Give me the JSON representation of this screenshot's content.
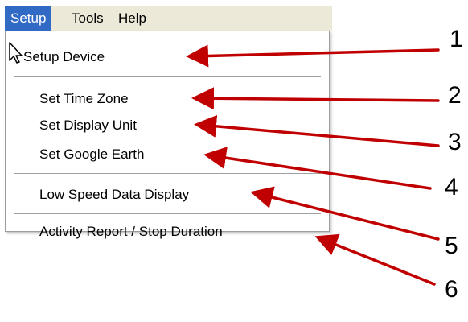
{
  "menubar": {
    "items": [
      {
        "label": "Setup",
        "active": true
      },
      {
        "label": "Tools",
        "active": false
      },
      {
        "label": "Help",
        "active": false
      }
    ]
  },
  "setup_menu": {
    "items": [
      {
        "label": "Setup Device",
        "hovered": true
      },
      {
        "label": "Set Time Zone"
      },
      {
        "label": "Set Display Unit"
      },
      {
        "label": "Set Google Earth"
      },
      {
        "label": "Low Speed Data Display"
      },
      {
        "label": "Activity Report / Stop Duration"
      }
    ]
  },
  "callouts": {
    "numbers": [
      "1",
      "2",
      "3",
      "4",
      "5",
      "6"
    ],
    "arrow_color": "#c00000"
  },
  "colors": {
    "menu_highlight": "#316ac5",
    "menubar_bg": "#ece9d8"
  }
}
